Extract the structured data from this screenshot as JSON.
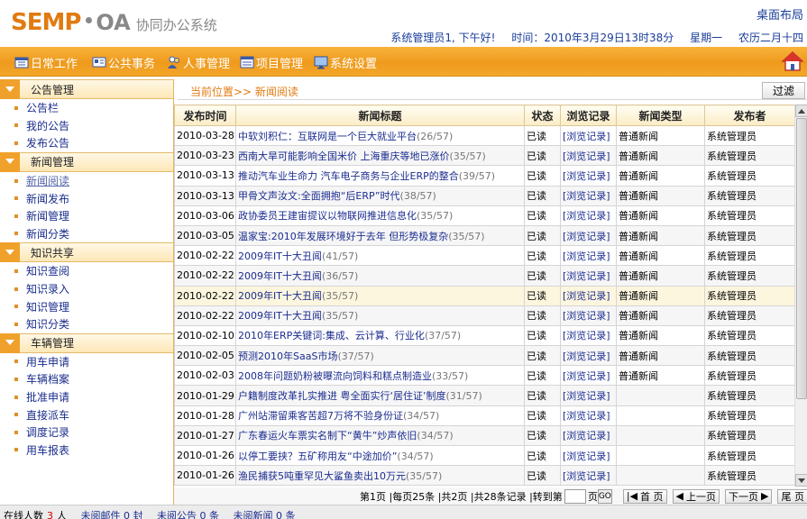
{
  "header": {
    "logo_brand": "SEMP",
    "logo_oa": "OA",
    "logo_system": "协同办公系统",
    "desk_layout": "桌面布局",
    "greeting": "系统管理员1, 下午好!",
    "datetime": "时间：2010年3月29日13时38分",
    "weekday": "星期一",
    "lunar": "农历二月十四"
  },
  "nav": {
    "items": [
      {
        "label": "日常工作",
        "icon": "calendar-icon"
      },
      {
        "label": "公共事务",
        "icon": "card-icon"
      },
      {
        "label": "人事管理",
        "icon": "people-icon"
      },
      {
        "label": "项目管理",
        "icon": "window-icon"
      },
      {
        "label": "系统设置",
        "icon": "monitor-icon"
      }
    ],
    "home_icon": "home-icon"
  },
  "sidebar": {
    "sections": [
      {
        "title": "公告管理",
        "items": [
          "公告栏",
          "我的公告",
          "发布公告"
        ]
      },
      {
        "title": "新闻管理",
        "items": [
          "新闻阅读",
          "新闻发布",
          "新闻管理",
          "新闻分类"
        ]
      },
      {
        "title": "知识共享",
        "items": [
          "知识查阅",
          "知识录入",
          "知识管理",
          "知识分类"
        ]
      },
      {
        "title": "车辆管理",
        "items": [
          "用车申请",
          "车辆档案",
          "批准申请",
          "直接派车",
          "调度记录",
          "用车报表"
        ]
      }
    ],
    "active_item": "新闻阅读"
  },
  "location": {
    "text": "当前位置>> 新闻阅读",
    "filter_label": "过滤"
  },
  "table": {
    "headers": [
      "发布时间",
      "新闻标题",
      "状态",
      "浏览记录",
      "新闻类型",
      "发布者"
    ],
    "rows": [
      {
        "date": "2010-03-28",
        "title": "中软刘积仁：互联网是一个巨大就业平台",
        "count": "(26/57)",
        "status": "已读",
        "log": "[浏览记录]",
        "type": "普通新闻",
        "publisher": "系统管理员"
      },
      {
        "date": "2010-03-23",
        "title": "西南大旱可能影响全国米价 上海重庆等地已涨价",
        "count": "(35/57)",
        "status": "已读",
        "log": "[浏览记录]",
        "type": "普通新闻",
        "publisher": "系统管理员"
      },
      {
        "date": "2010-03-13",
        "title": "推动汽车业生命力 汽车电子商务与企业ERP的整合",
        "count": "(39/57)",
        "status": "已读",
        "log": "[浏览记录]",
        "type": "普通新闻",
        "publisher": "系统管理员"
      },
      {
        "date": "2010-03-13",
        "title": "甲骨文声汝文:全面拥抱“后ERP”时代",
        "count": "(38/57)",
        "status": "已读",
        "log": "[浏览记录]",
        "type": "普通新闻",
        "publisher": "系统管理员"
      },
      {
        "date": "2010-03-06",
        "title": "政协委员王建宙提议以物联网推进信息化",
        "count": "(35/57)",
        "status": "已读",
        "log": "[浏览记录]",
        "type": "普通新闻",
        "publisher": "系统管理员"
      },
      {
        "date": "2010-03-05",
        "title": "温家宝:2010年发展环境好于去年 但形势极复杂",
        "count": "(35/57)",
        "status": "已读",
        "log": "[浏览记录]",
        "type": "普通新闻",
        "publisher": "系统管理员"
      },
      {
        "date": "2010-02-22",
        "title": "2009年IT十大丑闻",
        "count": "(41/57)",
        "status": "已读",
        "log": "[浏览记录]",
        "type": "普通新闻",
        "publisher": "系统管理员"
      },
      {
        "date": "2010-02-22",
        "title": "2009年IT十大丑闻",
        "count": "(36/57)",
        "status": "已读",
        "log": "[浏览记录]",
        "type": "普通新闻",
        "publisher": "系统管理员"
      },
      {
        "date": "2010-02-22",
        "title": "2009年IT十大丑闻",
        "count": "(35/57)",
        "status": "已读",
        "log": "[浏览记录]",
        "type": "普通新闻",
        "publisher": "系统管理员"
      },
      {
        "date": "2010-02-22",
        "title": "2009年IT十大丑闻",
        "count": "(35/57)",
        "status": "已读",
        "log": "[浏览记录]",
        "type": "普通新闻",
        "publisher": "系统管理员"
      },
      {
        "date": "2010-02-10",
        "title": "2010年ERP关键词:集成、云计算、行业化",
        "count": "(37/57)",
        "status": "已读",
        "log": "[浏览记录]",
        "type": "普通新闻",
        "publisher": "系统管理员"
      },
      {
        "date": "2010-02-05",
        "title": "预测2010年SaaS市场",
        "count": "(37/57)",
        "status": "已读",
        "log": "[浏览记录]",
        "type": "普通新闻",
        "publisher": "系统管理员"
      },
      {
        "date": "2010-02-03",
        "title": "2008年问题奶粉被曝流向饲料和糕点制造业",
        "count": "(33/57)",
        "status": "已读",
        "log": "[浏览记录]",
        "type": "普通新闻",
        "publisher": "系统管理员"
      },
      {
        "date": "2010-01-29",
        "title": "户籍制度改革扎实推进 粤全面实行‘居住证’制度",
        "count": "(31/57)",
        "status": "已读",
        "log": "[浏览记录]",
        "type": "",
        "publisher": "系统管理员"
      },
      {
        "date": "2010-01-28",
        "title": "广州站滞留乘客苦超7万将不验身份证",
        "count": "(34/57)",
        "status": "已读",
        "log": "[浏览记录]",
        "type": "",
        "publisher": "系统管理员"
      },
      {
        "date": "2010-01-27",
        "title": "广东春运火车票实名制下“黄牛”炒声依旧",
        "count": "(34/57)",
        "status": "已读",
        "log": "[浏览记录]",
        "type": "",
        "publisher": "系统管理员"
      },
      {
        "date": "2010-01-26",
        "title": "以停工要挟？五矿称用友“中途加价”",
        "count": "(34/57)",
        "status": "已读",
        "log": "[浏览记录]",
        "type": "",
        "publisher": "系统管理员"
      },
      {
        "date": "2010-01-26",
        "title": "渔民捕获5吨重罕见大鲨鱼卖出10万元",
        "count": "(35/57)",
        "status": "已读",
        "log": "[浏览记录]",
        "type": "",
        "publisher": "系统管理员"
      }
    ],
    "highlighted_row": 8
  },
  "pager": {
    "info": "第1页 |每页25条 |共2页 |共28条记录 |转到第",
    "page_suffix": "页",
    "go": "GO",
    "first": "首 页",
    "prev": "上一页",
    "next": "下一页",
    "last": "尾 页"
  },
  "footer": {
    "online_label": "在线人数",
    "online_count": "3",
    "online_unit": "人",
    "mail": "未阅邮件 0 封",
    "notice": "未阅公告 0 条",
    "news": "未阅新闻 0 条"
  },
  "colors": {
    "accent_orange": "#ee9a1d",
    "link_blue": "#1b2c8f",
    "logo_orange": "#e07b12"
  }
}
